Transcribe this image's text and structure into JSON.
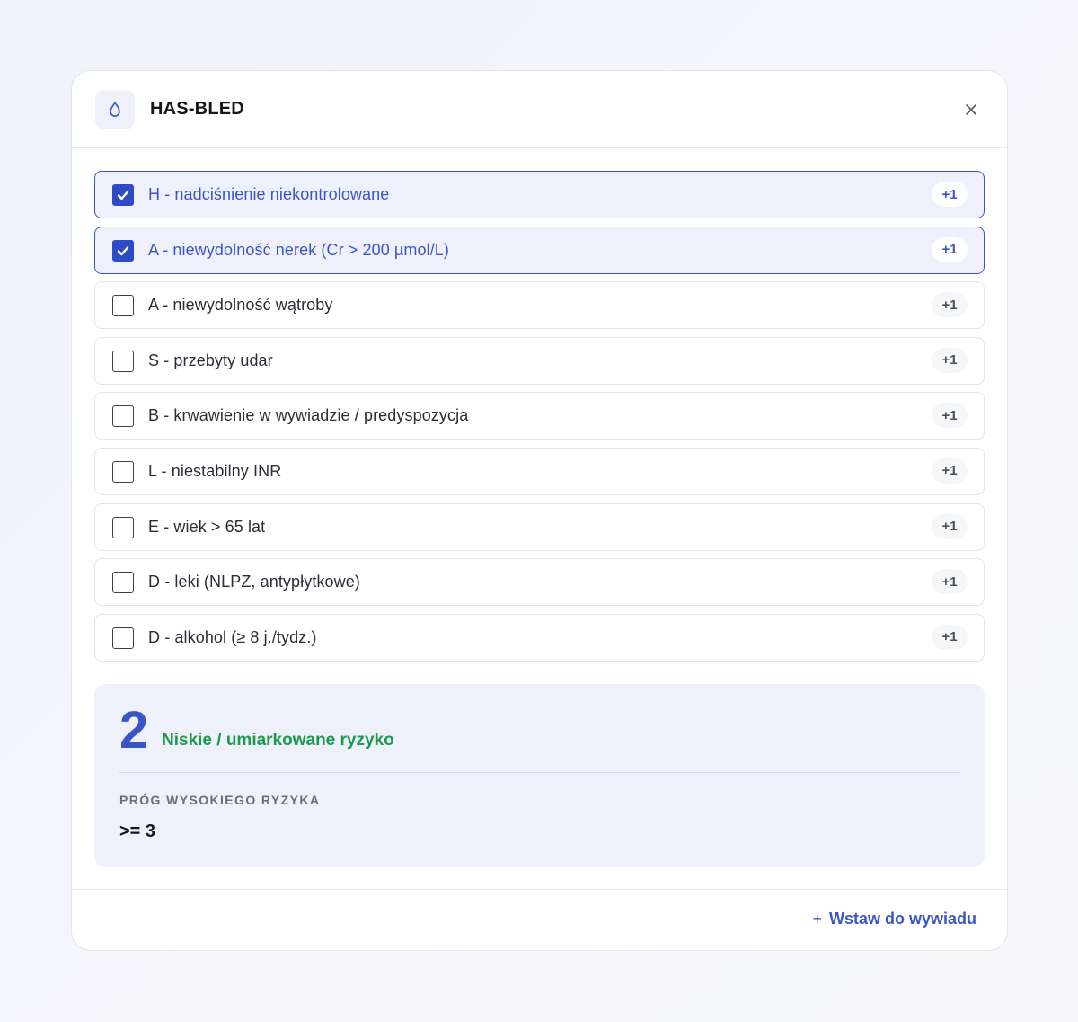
{
  "header": {
    "title": "HAS-BLED",
    "icon": "drop-icon"
  },
  "items": [
    {
      "label": "H - nadciśnienie niekontrolowane",
      "points": "+1",
      "checked": true
    },
    {
      "label": "A - niewydolność nerek (Cr > 200 µmol/L)",
      "points": "+1",
      "checked": true
    },
    {
      "label": "A - niewydolność wątroby",
      "points": "+1",
      "checked": false
    },
    {
      "label": "S - przebyty udar",
      "points": "+1",
      "checked": false
    },
    {
      "label": "B - krwawienie w wywiadzie / predyspozycja",
      "points": "+1",
      "checked": false
    },
    {
      "label": "L - niestabilny INR",
      "points": "+1",
      "checked": false
    },
    {
      "label": "E - wiek > 65 lat",
      "points": "+1",
      "checked": false
    },
    {
      "label": "D - leki (NLPZ, antypłytkowe)",
      "points": "+1",
      "checked": false
    },
    {
      "label": "D - alkohol (≥ 8 j./tydz.)",
      "points": "+1",
      "checked": false
    }
  ],
  "result": {
    "score": "2",
    "risk_label": "Niskie / umiarkowane ryzyko",
    "threshold_label": "PRÓG WYSOKIEGO RYZYKA",
    "threshold_value": ">= 3"
  },
  "footer": {
    "insert_plus": "+",
    "insert_label": "Wstaw do wywiadu"
  },
  "colors": {
    "accent": "#3b55c9",
    "risk_low": "#1c9a4c",
    "panel_bg": "#eef0fb"
  }
}
